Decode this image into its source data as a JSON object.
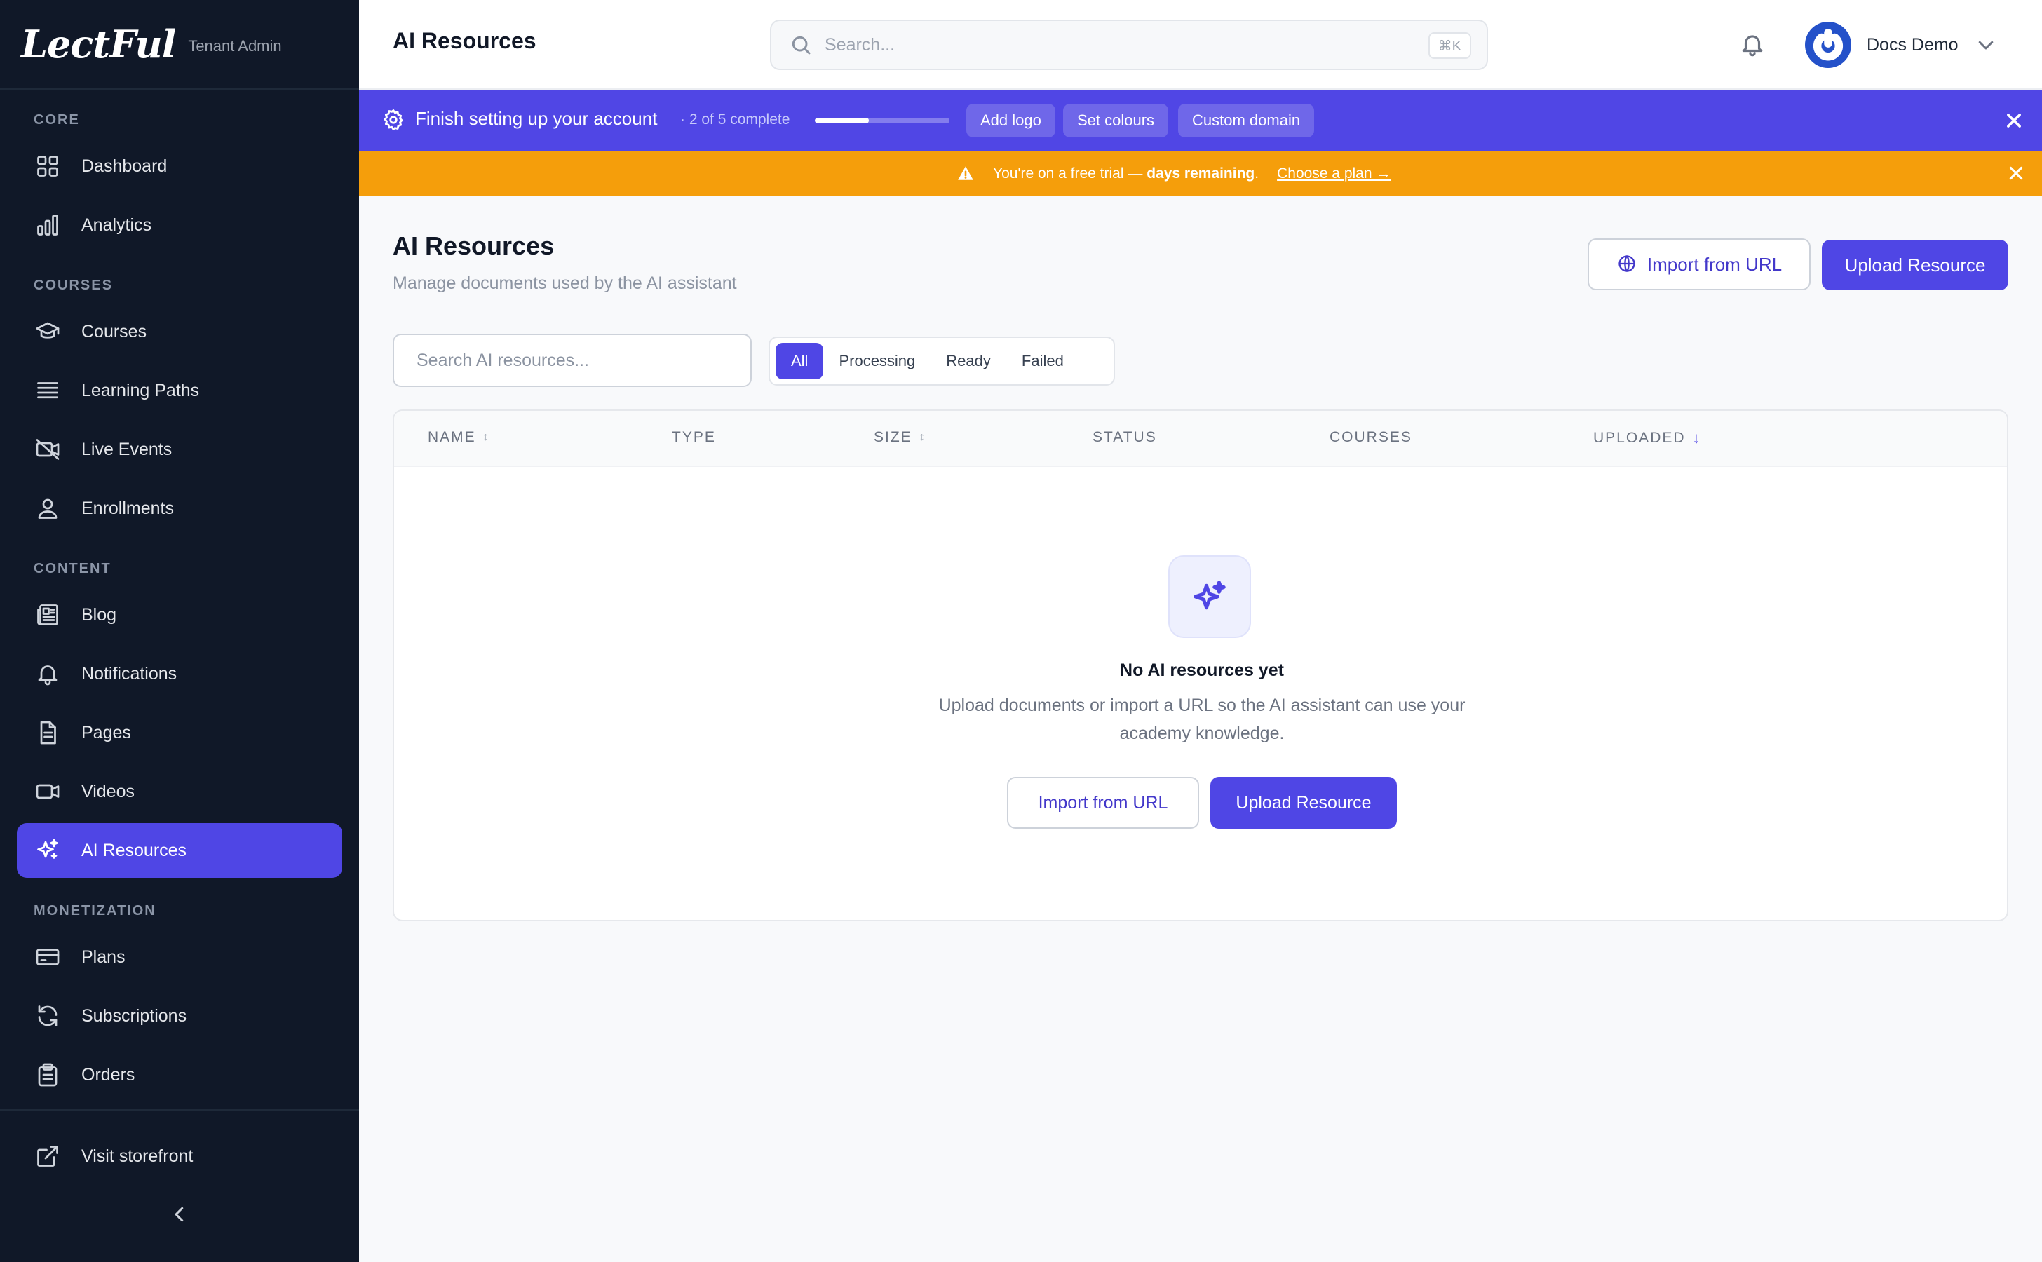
{
  "brand": {
    "logo": "LectFul",
    "subtitle": "Tenant Admin"
  },
  "sidebar": {
    "sections": [
      {
        "label": "CORE"
      },
      {
        "label": "COURSES"
      },
      {
        "label": "CONTENT"
      },
      {
        "label": "MONETIZATION"
      }
    ],
    "items": [
      {
        "label": "Dashboard",
        "icon": "grid-icon"
      },
      {
        "label": "Analytics",
        "icon": "bar-chart-icon"
      },
      {
        "label": "Courses",
        "icon": "graduation-cap-icon"
      },
      {
        "label": "Learning Paths",
        "icon": "stack-lines-icon"
      },
      {
        "label": "Live Events",
        "icon": "video-off-icon"
      },
      {
        "label": "Enrollments",
        "icon": "user-icon"
      },
      {
        "label": "Blog",
        "icon": "newspaper-icon"
      },
      {
        "label": "Notifications",
        "icon": "bell-icon"
      },
      {
        "label": "Pages",
        "icon": "document-icon"
      },
      {
        "label": "Videos",
        "icon": "video-camera-icon"
      },
      {
        "label": "AI Resources",
        "icon": "sparkles-icon",
        "active": true
      },
      {
        "label": "Plans",
        "icon": "credit-card-icon"
      },
      {
        "label": "Subscriptions",
        "icon": "refresh-icon"
      },
      {
        "label": "Orders",
        "icon": "clipboard-icon"
      }
    ],
    "footer": {
      "storefront_label": "Visit storefront"
    }
  },
  "header": {
    "title": "AI Resources",
    "search_placeholder": "Search...",
    "search_shortcut": "⌘K",
    "user_name": "Docs Demo"
  },
  "setup_banner": {
    "title": "Finish setting up your account",
    "progress_text": "· 2 of 5 complete",
    "progress_fraction": 0.4,
    "chips": [
      "Add logo",
      "Set colours",
      "Custom domain"
    ]
  },
  "trial_banner": {
    "text_prefix": "You're on a free trial — ",
    "text_bold": "days remaining",
    "text_suffix": ".",
    "link": "Choose a plan →"
  },
  "main": {
    "title": "AI Resources",
    "subtitle": "Manage documents used by the AI assistant",
    "import_button": "Import from URL",
    "upload_button": "Upload Resource",
    "search_placeholder": "Search AI resources...",
    "filters": [
      "All",
      "Processing",
      "Ready",
      "Failed"
    ],
    "active_filter": "All",
    "columns": [
      {
        "label": "NAME",
        "sort": "↕"
      },
      {
        "label": "TYPE",
        "sort": ""
      },
      {
        "label": "SIZE",
        "sort": "↕"
      },
      {
        "label": "STATUS",
        "sort": ""
      },
      {
        "label": "COURSES",
        "sort": ""
      },
      {
        "label": "UPLOADED",
        "sort": "↓"
      }
    ],
    "empty": {
      "title": "No AI resources yet",
      "text": "Upload documents or import a URL so the AI assistant can use your academy knowledge.",
      "import_button": "Import from URL",
      "upload_button": "Upload Resource"
    }
  },
  "colors": {
    "sidebar_bg": "#101828",
    "accent": "#4f46e5",
    "setup_banner_bg": "#5046e5",
    "trial_banner_bg": "#f59e0b"
  }
}
